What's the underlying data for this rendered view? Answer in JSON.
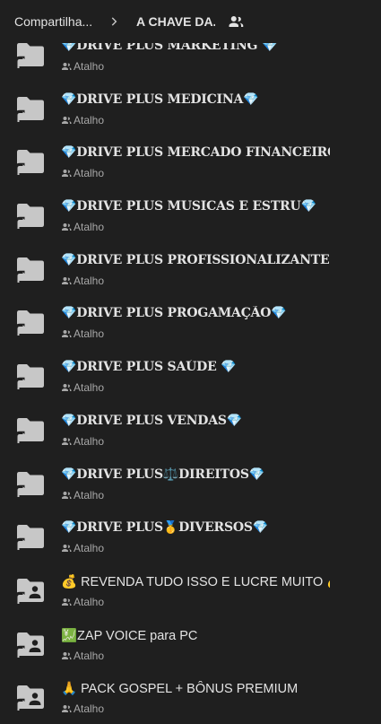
{
  "breadcrumb": {
    "parent": "Compartilha...",
    "current": "A CHAVE DA..."
  },
  "subtitle": "Atalho",
  "icons": {
    "chevron": "chevron-right-icon",
    "shared": "people-icon",
    "folder": "folder-shortcut-icon",
    "shared_folder": "shared-folder-shortcut-icon",
    "more": "more-vert-icon"
  },
  "colors": {
    "background": "#1f1f1f",
    "text": "#e3e3e3",
    "muted": "#a8a8a8",
    "icon": "#c7c7c7"
  },
  "items": [
    {
      "title": "💎DRIVE PLUS MARKETING 💎",
      "type": "folder",
      "style": "serif"
    },
    {
      "title": "💎DRIVE PLUS MEDICINA💎",
      "type": "folder",
      "style": "serif"
    },
    {
      "title": "💎DRIVE PLUS MERCADO FINANCEIRO💎",
      "type": "folder",
      "style": "serif"
    },
    {
      "title": "💎DRIVE PLUS MUSICAS E ESTRU💎",
      "type": "folder",
      "style": "serif"
    },
    {
      "title": "💎DRIVE PLUS PROFISSIONALIZANTES...",
      "type": "folder",
      "style": "serif"
    },
    {
      "title": "💎DRIVE PLUS PROGAMAÇÃO💎",
      "type": "folder",
      "style": "serif"
    },
    {
      "title": "💎DRIVE PLUS SAÚDE 💎",
      "type": "folder",
      "style": "serif"
    },
    {
      "title": "💎DRIVE PLUS VENDAS💎",
      "type": "folder",
      "style": "serif"
    },
    {
      "title": "💎DRIVE PLUS⚖️DIREITOS💎",
      "type": "folder",
      "style": "serif"
    },
    {
      "title": "💎DRIVE PLUS🥇DIVERSOS💎",
      "type": "folder",
      "style": "serif"
    },
    {
      "title": "💰 REVENDA TUDO ISSO E LUCRE MUITO 💰",
      "type": "shared",
      "style": "sans"
    },
    {
      "title": "💹ZAP VOICE para PC",
      "type": "shared",
      "style": "sans"
    },
    {
      "title": "🙏 PACK GOSPEL + BÔNUS PREMIUM",
      "type": "shared",
      "style": "sans"
    }
  ]
}
